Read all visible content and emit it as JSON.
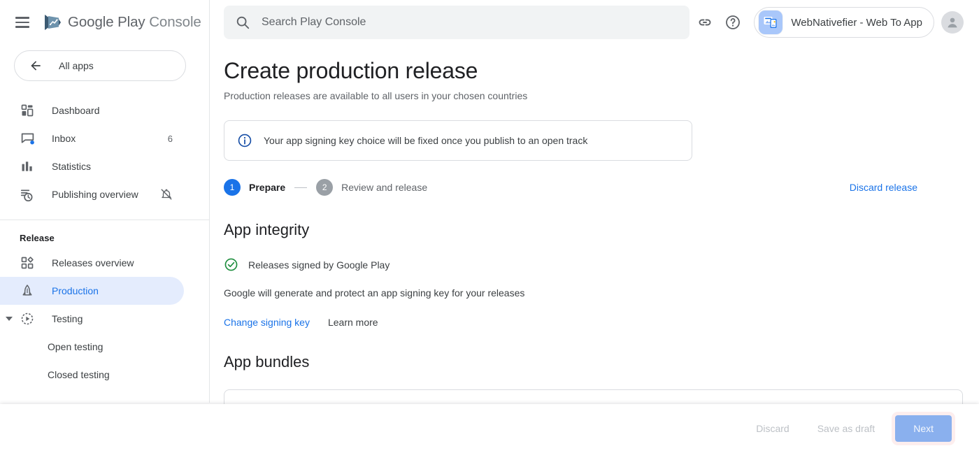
{
  "brand": {
    "logo_icon": "google-play-console-logo",
    "name_primary": "Google Play",
    "name_secondary": "Console",
    "menu_icon": "hamburger-menu-icon"
  },
  "sidebar": {
    "all_apps": {
      "label": "All apps",
      "icon": "arrow-back-icon"
    },
    "items": [
      {
        "label": "Dashboard",
        "icon": "dashboard-icon",
        "trailing": "",
        "active": false
      },
      {
        "label": "Inbox",
        "icon": "inbox-icon",
        "trailing": "6",
        "active": false
      },
      {
        "label": "Statistics",
        "icon": "statistics-icon",
        "trailing": "",
        "active": false
      },
      {
        "label": "Publishing overview",
        "icon": "publishing-overview-icon",
        "trailing": "bell-off-icon",
        "active": false
      }
    ],
    "release_section": {
      "label": "Release",
      "items": [
        {
          "label": "Releases overview",
          "icon": "releases-overview-icon",
          "active": false
        },
        {
          "label": "Production",
          "icon": "rocket-icon",
          "active": true
        },
        {
          "label": "Testing",
          "icon": "testing-icon",
          "active": false,
          "expandable": true
        }
      ],
      "sub_items": [
        {
          "label": "Open testing"
        },
        {
          "label": "Closed testing"
        }
      ]
    }
  },
  "header": {
    "search": {
      "placeholder": "Search Play Console",
      "value": "",
      "icon": "search-icon"
    },
    "link_icon": "link-icon",
    "help_icon": "help-circle-icon",
    "app_selector": {
      "name": "WebNativefier - Web To App",
      "icon": "app-thumbnail-icon"
    },
    "avatar": "account-avatar-icon"
  },
  "main": {
    "title": "Create production release",
    "subtitle": "Production releases are available to all users in your chosen countries",
    "notice": {
      "icon": "info-icon",
      "text": "Your app signing key choice will be fixed once you publish to an open track"
    },
    "stepper": {
      "steps": [
        {
          "number": "1",
          "label": "Prepare",
          "state": "active"
        },
        {
          "number": "2",
          "label": "Review and release",
          "state": "inactive"
        }
      ],
      "discard_release_label": "Discard release"
    },
    "app_integrity": {
      "heading": "App integrity",
      "status_icon": "check-circle-icon",
      "status_text": "Releases signed by Google Play",
      "description": "Google will generate and protect an app signing key for your releases",
      "links": [
        {
          "label": "Change signing key",
          "style": "primary"
        },
        {
          "label": "Learn more",
          "style": "plain"
        }
      ]
    },
    "app_bundles": {
      "heading": "App bundles"
    }
  },
  "footer": {
    "discard_label": "Discard",
    "save_draft_label": "Save as draft",
    "next_label": "Next"
  },
  "colors": {
    "accent_blue": "#1a73e8",
    "active_pill": "#e4ecfd",
    "success_green": "#1e8e3e",
    "info_blue": "#174ea6",
    "step_inactive": "#9aa0a6",
    "primary_button": "#8ab0ee",
    "focus_ring": "#fdeeee"
  }
}
